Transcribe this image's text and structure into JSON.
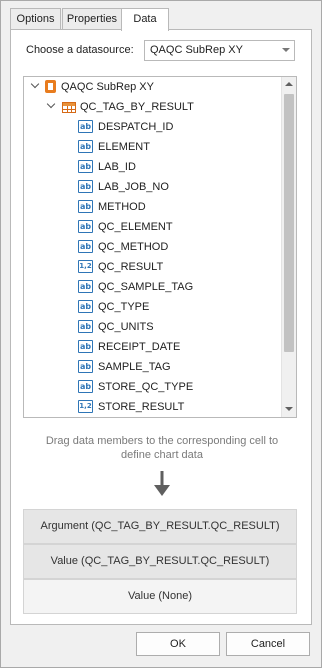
{
  "tabs": [
    {
      "label": "Options"
    },
    {
      "label": "Properties"
    },
    {
      "label": "Data",
      "selected": true
    }
  ],
  "datasource": {
    "label": "Choose a datasource:",
    "value": "QAQC SubRep XY"
  },
  "tree": {
    "root": {
      "label": "QAQC SubRep XY",
      "icon": "datasource-icon",
      "expanded": true
    },
    "table": {
      "label": "QC_TAG_BY_RESULT",
      "icon": "table-icon",
      "expanded": true
    },
    "fields": [
      {
        "label": "DESPATCH_ID",
        "type": "ab"
      },
      {
        "label": "ELEMENT",
        "type": "ab"
      },
      {
        "label": "LAB_ID",
        "type": "ab"
      },
      {
        "label": "LAB_JOB_NO",
        "type": "ab"
      },
      {
        "label": "METHOD",
        "type": "ab"
      },
      {
        "label": "QC_ELEMENT",
        "type": "ab"
      },
      {
        "label": "QC_METHOD",
        "type": "ab"
      },
      {
        "label": "QC_RESULT",
        "type": "1,2"
      },
      {
        "label": "QC_SAMPLE_TAG",
        "type": "ab"
      },
      {
        "label": "QC_TYPE",
        "type": "ab"
      },
      {
        "label": "QC_UNITS",
        "type": "ab"
      },
      {
        "label": "RECEIPT_DATE",
        "type": "ab"
      },
      {
        "label": "SAMPLE_TAG",
        "type": "ab"
      },
      {
        "label": "STORE_QC_TYPE",
        "type": "ab"
      },
      {
        "label": "STORE_RESULT",
        "type": "1,2"
      }
    ]
  },
  "hint": {
    "line1": "Drag data members to the corresponding cell to",
    "line2": "define chart data"
  },
  "zones": {
    "argument": "Argument (QC_TAG_BY_RESULT.QC_RESULT)",
    "value": "Value (QC_TAG_BY_RESULT.QC_RESULT)",
    "value_none": "Value (None)"
  },
  "buttons": {
    "ok": "OK",
    "cancel": "Cancel"
  },
  "colors": {
    "field_icon": "#2e75b6",
    "datasource_icon": "#e87c1e",
    "hint_text": "#7a7a7a"
  }
}
